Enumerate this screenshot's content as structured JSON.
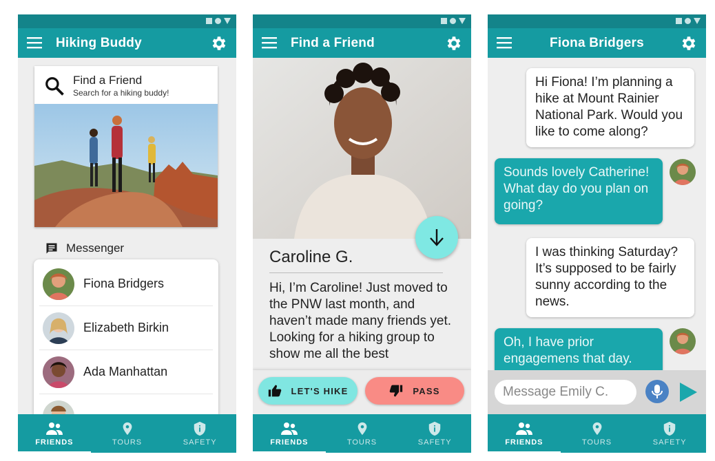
{
  "screens": [
    {
      "appbar_title": "Hiking Buddy",
      "card": {
        "title": "Find a Friend",
        "subtitle": "Search for a hiking buddy!"
      },
      "messenger_label": "Messenger",
      "contacts": [
        "Fiona Bridgers",
        "Elizabeth Birkin",
        "Ada Manhattan"
      ]
    },
    {
      "appbar_title": "Find a Friend",
      "profile_name": "Caroline G.",
      "bio": "Hi, I’m Caroline! Just moved to the PNW last month, and haven’t made many friends yet. Looking for a hiking group to show me all the best",
      "like_label": "LET'S HIKE",
      "pass_label": "PASS"
    },
    {
      "appbar_title": "Fiona Bridgers",
      "messages": [
        {
          "from": "me",
          "text": "Hi Fiona! I’m planning a hike at Mount Rainier National Park. Would you like to come along?"
        },
        {
          "from": "them",
          "text": "Sounds lovely Catherine! What day do you plan on going?"
        },
        {
          "from": "me",
          "text": "I was thinking Saturday? It’s supposed to be fairly sunny according to the news."
        },
        {
          "from": "them",
          "text": "Oh, I have prior engagemens that day."
        }
      ],
      "composer_placeholder": "Message Emily C."
    }
  ],
  "nav": [
    "FRIENDS",
    "TOURS",
    "SAFETY"
  ],
  "colors": {
    "primary": "#159ba1",
    "primary_dark": "#13848a",
    "accent": "#80e6e1",
    "pass": "#f98b85",
    "bubble_in": "#1aa7ac"
  },
  "icons": [
    "menu-icon",
    "gear-icon",
    "search-icon",
    "chat-icon",
    "arrow-down-icon",
    "thumb-up-icon",
    "thumb-down-icon",
    "mic-icon",
    "send-icon",
    "people-icon",
    "location-pin-icon",
    "shield-icon"
  ]
}
